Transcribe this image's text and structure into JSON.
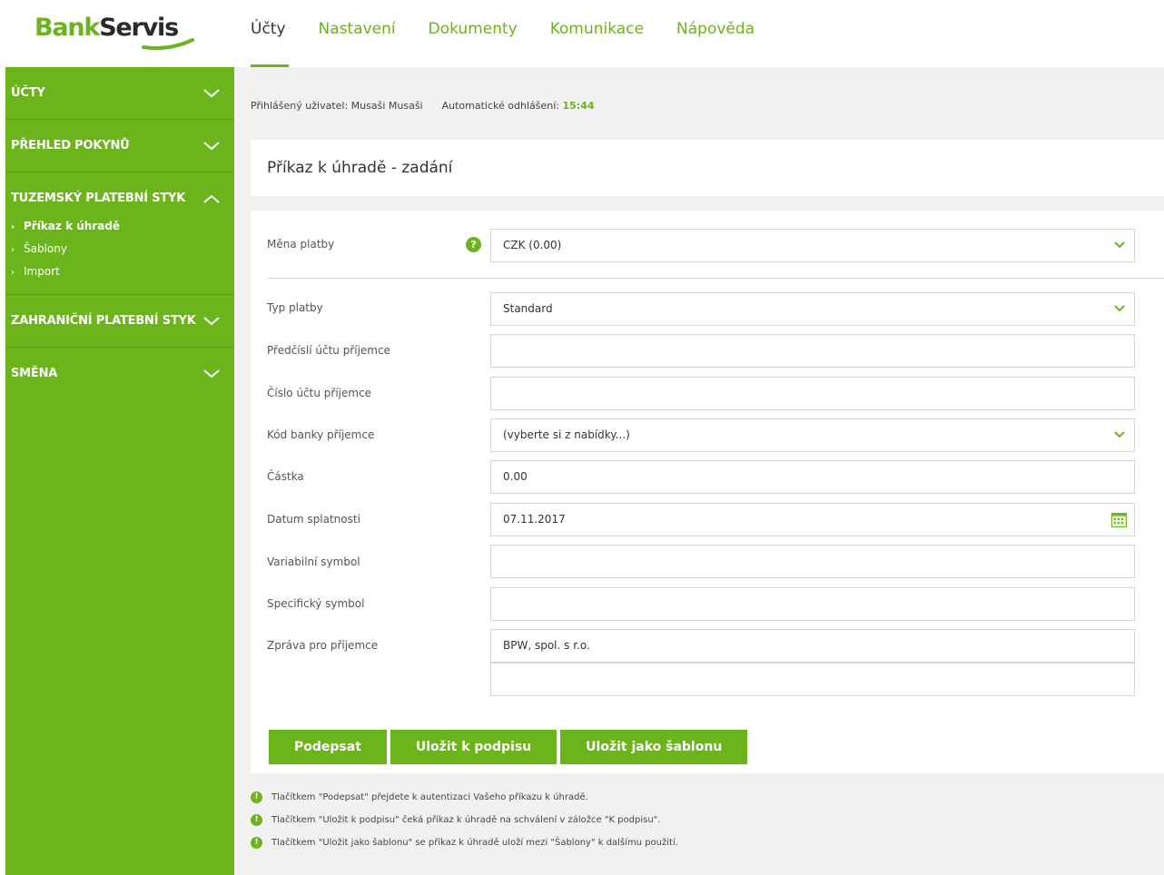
{
  "logo": {
    "part1": "Bank",
    "part2": "Servis"
  },
  "topnav": [
    {
      "label": "Účty",
      "active": true
    },
    {
      "label": "Nastavení"
    },
    {
      "label": "Dokumenty"
    },
    {
      "label": "Komunikace"
    },
    {
      "label": "Nápověda"
    }
  ],
  "sidebar": {
    "sections": [
      {
        "label": "ÚČTY"
      },
      {
        "label": "PŘEHLED POKYNŮ"
      },
      {
        "label": "TUZEMSKÝ PLATEBNÍ STYK",
        "expanded": true,
        "items": [
          {
            "label": "Příkaz k úhradě",
            "active": true
          },
          {
            "label": "Šablony"
          },
          {
            "label": "Import"
          }
        ]
      },
      {
        "label": "ZAHRANIČNÍ PLATEBNÍ STYK"
      },
      {
        "label": "SMĚNA"
      }
    ]
  },
  "userbar": {
    "logged_label": "Přihlášený uživatel:",
    "user": "Musaši Musaši",
    "logout_label": "Automatické odhlášení:",
    "logout_time": "15:44"
  },
  "page_title": "Příkaz k úhradě - zadání",
  "form": {
    "currency": {
      "label": "Měna platby",
      "value": "CZK (0.00)",
      "help": "?"
    },
    "payment_type": {
      "label": "Typ platby",
      "value": "Standard"
    },
    "account_prefix": {
      "label": "Předčíslí účtu příjemce",
      "value": ""
    },
    "account_number": {
      "label": "Číslo účtu příjemce",
      "value": ""
    },
    "bank_code": {
      "label": "Kód banky příjemce",
      "value": "(vyberte si z nabídky...)"
    },
    "amount": {
      "label": "Částka",
      "value": "0.00"
    },
    "due_date": {
      "label": "Datum splatnosti",
      "value": "07.11.2017"
    },
    "variable_symbol": {
      "label": "Variabilní symbol",
      "value": ""
    },
    "specific_symbol": {
      "label": "Specifický symbol",
      "value": ""
    },
    "message": {
      "label": "Zpráva pro příjemce",
      "line1": "BPW, spol. s r.o.",
      "line2": ""
    }
  },
  "buttons": {
    "sign": "Podepsat",
    "save_for_sign": "Uložit k podpisu",
    "save_template": "Uložit jako šablonu"
  },
  "notes": [
    "Tlačítkem \"Podepsat\" přejdete k autentizaci Vašeho příkazu k úhradě.",
    "Tlačítkem \"Uložit k podpisu\" čeká příkaz k úhradě na schválení v záložce \"K podpisu\".",
    "Tlačítkem \"Uložit jako šablonu\" se příkaz k úhradě uloží mezi \"Šablony\" k dalšímu použití."
  ],
  "colors": {
    "accent": "#6cb41c",
    "text": "#333333",
    "background": "#f1f1f1"
  }
}
